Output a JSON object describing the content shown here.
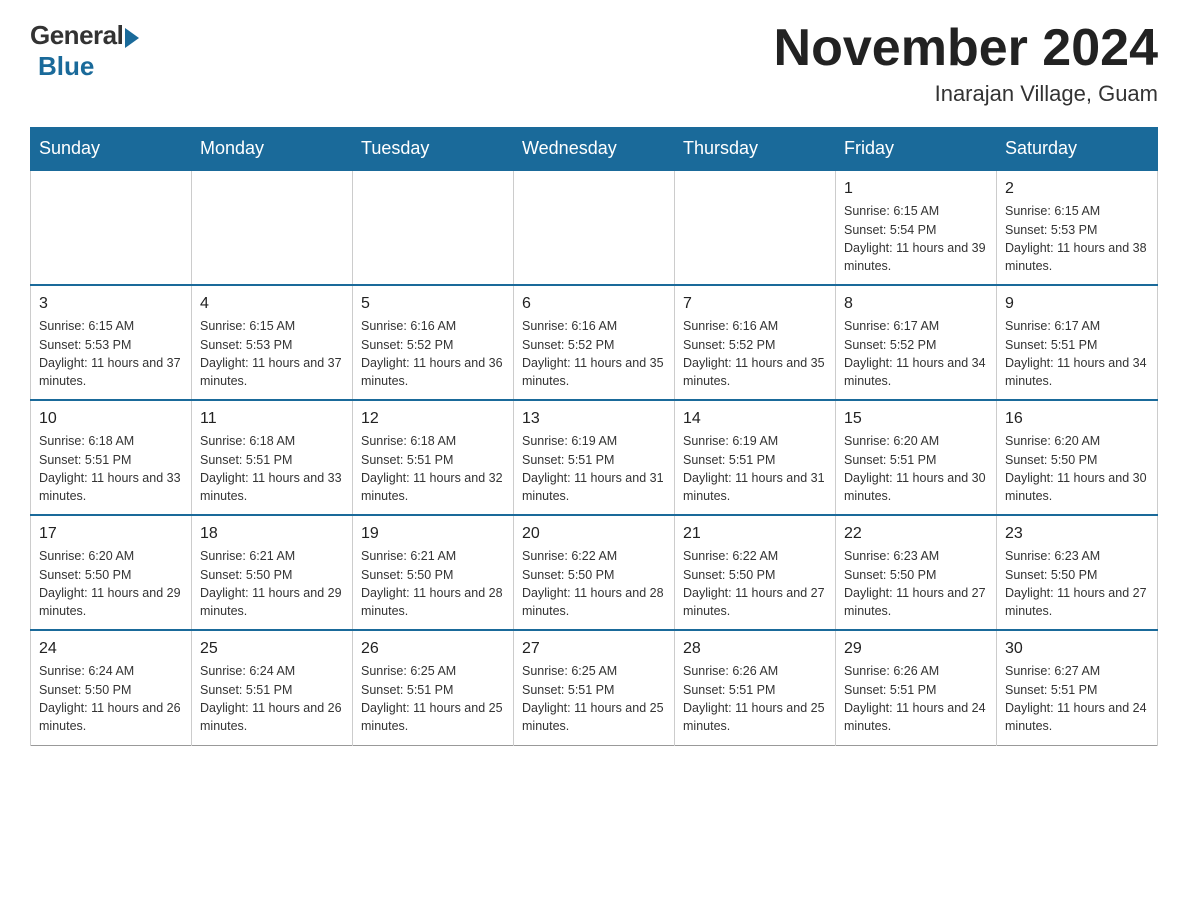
{
  "header": {
    "logo_general": "General",
    "logo_blue": "Blue",
    "month_title": "November 2024",
    "location": "Inarajan Village, Guam"
  },
  "weekdays": [
    "Sunday",
    "Monday",
    "Tuesday",
    "Wednesday",
    "Thursday",
    "Friday",
    "Saturday"
  ],
  "weeks": [
    [
      {
        "day": "",
        "sunrise": "",
        "sunset": "",
        "daylight": ""
      },
      {
        "day": "",
        "sunrise": "",
        "sunset": "",
        "daylight": ""
      },
      {
        "day": "",
        "sunrise": "",
        "sunset": "",
        "daylight": ""
      },
      {
        "day": "",
        "sunrise": "",
        "sunset": "",
        "daylight": ""
      },
      {
        "day": "",
        "sunrise": "",
        "sunset": "",
        "daylight": ""
      },
      {
        "day": "1",
        "sunrise": "Sunrise: 6:15 AM",
        "sunset": "Sunset: 5:54 PM",
        "daylight": "Daylight: 11 hours and 39 minutes."
      },
      {
        "day": "2",
        "sunrise": "Sunrise: 6:15 AM",
        "sunset": "Sunset: 5:53 PM",
        "daylight": "Daylight: 11 hours and 38 minutes."
      }
    ],
    [
      {
        "day": "3",
        "sunrise": "Sunrise: 6:15 AM",
        "sunset": "Sunset: 5:53 PM",
        "daylight": "Daylight: 11 hours and 37 minutes."
      },
      {
        "day": "4",
        "sunrise": "Sunrise: 6:15 AM",
        "sunset": "Sunset: 5:53 PM",
        "daylight": "Daylight: 11 hours and 37 minutes."
      },
      {
        "day": "5",
        "sunrise": "Sunrise: 6:16 AM",
        "sunset": "Sunset: 5:52 PM",
        "daylight": "Daylight: 11 hours and 36 minutes."
      },
      {
        "day": "6",
        "sunrise": "Sunrise: 6:16 AM",
        "sunset": "Sunset: 5:52 PM",
        "daylight": "Daylight: 11 hours and 35 minutes."
      },
      {
        "day": "7",
        "sunrise": "Sunrise: 6:16 AM",
        "sunset": "Sunset: 5:52 PM",
        "daylight": "Daylight: 11 hours and 35 minutes."
      },
      {
        "day": "8",
        "sunrise": "Sunrise: 6:17 AM",
        "sunset": "Sunset: 5:52 PM",
        "daylight": "Daylight: 11 hours and 34 minutes."
      },
      {
        "day": "9",
        "sunrise": "Sunrise: 6:17 AM",
        "sunset": "Sunset: 5:51 PM",
        "daylight": "Daylight: 11 hours and 34 minutes."
      }
    ],
    [
      {
        "day": "10",
        "sunrise": "Sunrise: 6:18 AM",
        "sunset": "Sunset: 5:51 PM",
        "daylight": "Daylight: 11 hours and 33 minutes."
      },
      {
        "day": "11",
        "sunrise": "Sunrise: 6:18 AM",
        "sunset": "Sunset: 5:51 PM",
        "daylight": "Daylight: 11 hours and 33 minutes."
      },
      {
        "day": "12",
        "sunrise": "Sunrise: 6:18 AM",
        "sunset": "Sunset: 5:51 PM",
        "daylight": "Daylight: 11 hours and 32 minutes."
      },
      {
        "day": "13",
        "sunrise": "Sunrise: 6:19 AM",
        "sunset": "Sunset: 5:51 PM",
        "daylight": "Daylight: 11 hours and 31 minutes."
      },
      {
        "day": "14",
        "sunrise": "Sunrise: 6:19 AM",
        "sunset": "Sunset: 5:51 PM",
        "daylight": "Daylight: 11 hours and 31 minutes."
      },
      {
        "day": "15",
        "sunrise": "Sunrise: 6:20 AM",
        "sunset": "Sunset: 5:51 PM",
        "daylight": "Daylight: 11 hours and 30 minutes."
      },
      {
        "day": "16",
        "sunrise": "Sunrise: 6:20 AM",
        "sunset": "Sunset: 5:50 PM",
        "daylight": "Daylight: 11 hours and 30 minutes."
      }
    ],
    [
      {
        "day": "17",
        "sunrise": "Sunrise: 6:20 AM",
        "sunset": "Sunset: 5:50 PM",
        "daylight": "Daylight: 11 hours and 29 minutes."
      },
      {
        "day": "18",
        "sunrise": "Sunrise: 6:21 AM",
        "sunset": "Sunset: 5:50 PM",
        "daylight": "Daylight: 11 hours and 29 minutes."
      },
      {
        "day": "19",
        "sunrise": "Sunrise: 6:21 AM",
        "sunset": "Sunset: 5:50 PM",
        "daylight": "Daylight: 11 hours and 28 minutes."
      },
      {
        "day": "20",
        "sunrise": "Sunrise: 6:22 AM",
        "sunset": "Sunset: 5:50 PM",
        "daylight": "Daylight: 11 hours and 28 minutes."
      },
      {
        "day": "21",
        "sunrise": "Sunrise: 6:22 AM",
        "sunset": "Sunset: 5:50 PM",
        "daylight": "Daylight: 11 hours and 27 minutes."
      },
      {
        "day": "22",
        "sunrise": "Sunrise: 6:23 AM",
        "sunset": "Sunset: 5:50 PM",
        "daylight": "Daylight: 11 hours and 27 minutes."
      },
      {
        "day": "23",
        "sunrise": "Sunrise: 6:23 AM",
        "sunset": "Sunset: 5:50 PM",
        "daylight": "Daylight: 11 hours and 27 minutes."
      }
    ],
    [
      {
        "day": "24",
        "sunrise": "Sunrise: 6:24 AM",
        "sunset": "Sunset: 5:50 PM",
        "daylight": "Daylight: 11 hours and 26 minutes."
      },
      {
        "day": "25",
        "sunrise": "Sunrise: 6:24 AM",
        "sunset": "Sunset: 5:51 PM",
        "daylight": "Daylight: 11 hours and 26 minutes."
      },
      {
        "day": "26",
        "sunrise": "Sunrise: 6:25 AM",
        "sunset": "Sunset: 5:51 PM",
        "daylight": "Daylight: 11 hours and 25 minutes."
      },
      {
        "day": "27",
        "sunrise": "Sunrise: 6:25 AM",
        "sunset": "Sunset: 5:51 PM",
        "daylight": "Daylight: 11 hours and 25 minutes."
      },
      {
        "day": "28",
        "sunrise": "Sunrise: 6:26 AM",
        "sunset": "Sunset: 5:51 PM",
        "daylight": "Daylight: 11 hours and 25 minutes."
      },
      {
        "day": "29",
        "sunrise": "Sunrise: 6:26 AM",
        "sunset": "Sunset: 5:51 PM",
        "daylight": "Daylight: 11 hours and 24 minutes."
      },
      {
        "day": "30",
        "sunrise": "Sunrise: 6:27 AM",
        "sunset": "Sunset: 5:51 PM",
        "daylight": "Daylight: 11 hours and 24 minutes."
      }
    ]
  ]
}
